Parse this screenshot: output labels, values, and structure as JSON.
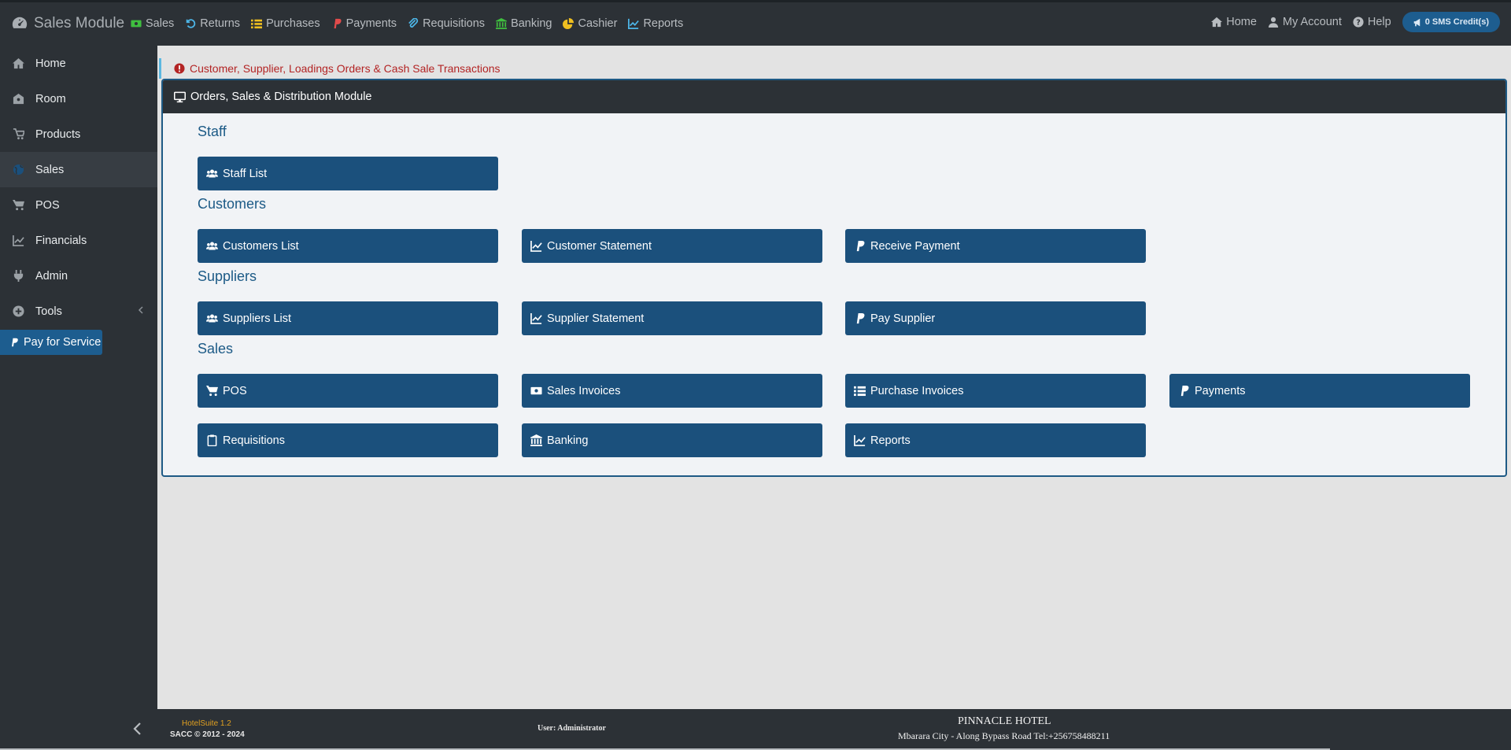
{
  "brand": {
    "title": "Sales Module"
  },
  "topnav": [
    {
      "label": "Sales",
      "icon": "money-icon",
      "color": "#3fbf3f"
    },
    {
      "label": "Returns",
      "icon": "undo-icon",
      "color": "#4db6e8"
    },
    {
      "label": "Purchases",
      "icon": "list-icon",
      "color": "#f0c020"
    },
    {
      "label": "Payments",
      "icon": "paypal-icon",
      "color": "#e24b4b"
    },
    {
      "label": "Requisitions",
      "icon": "paperclip-icon",
      "color": "#4db6e8"
    },
    {
      "label": "Banking",
      "icon": "bank-icon",
      "color": "#3fbf3f"
    },
    {
      "label": "Cashier",
      "icon": "piechart-icon",
      "color": "#f0c020"
    },
    {
      "label": "Reports",
      "icon": "linechart-icon",
      "color": "#4db6e8"
    }
  ],
  "rightnav": {
    "home": "Home",
    "account": "My Account",
    "help": "Help",
    "sms": "0 SMS Credit(s)"
  },
  "sidebar": {
    "items": [
      {
        "label": "Home",
        "icon": "home-icon"
      },
      {
        "label": "Room",
        "icon": "room-icon"
      },
      {
        "label": "Products",
        "icon": "cart-icon"
      },
      {
        "label": "Sales",
        "icon": "globe-icon"
      },
      {
        "label": "POS",
        "icon": "shopping-cart-icon"
      },
      {
        "label": "Financials",
        "icon": "linechart-icon"
      },
      {
        "label": "Admin",
        "icon": "plug-icon"
      },
      {
        "label": "Tools",
        "icon": "plus-circle-icon"
      }
    ],
    "active": "Sales",
    "pay_service": "Pay for Service"
  },
  "alert": "Customer, Supplier, Loadings Orders & Cash Sale Transactions",
  "panel": {
    "title": "Orders, Sales & Distribution Module",
    "sections": {
      "staff": "Staff",
      "customers": "Customers",
      "suppliers": "Suppliers",
      "sales": "Sales"
    },
    "buttons": {
      "staff_list": "Staff List",
      "customers_list": "Customers List",
      "customer_statement": "Customer Statement",
      "receive_payment": "Receive Payment",
      "suppliers_list": "Suppliers List",
      "supplier_statement": "Supplier Statement",
      "pay_supplier": "Pay Supplier",
      "pos": "POS",
      "sales_invoices": "Sales Invoices",
      "purchase_invoices": "Purchase Invoices",
      "payments": "Payments",
      "requisitions": "Requisitions",
      "banking": "Banking",
      "reports": "Reports"
    }
  },
  "footer": {
    "version": "HotelSuite 1.2",
    "copyright": "SACC © 2012 - 2024",
    "user": "User: Administrator",
    "hotel": "PINNACLE HOTEL",
    "address": "Mbarara City - Along Bypass Road Tel:+256758488211"
  }
}
